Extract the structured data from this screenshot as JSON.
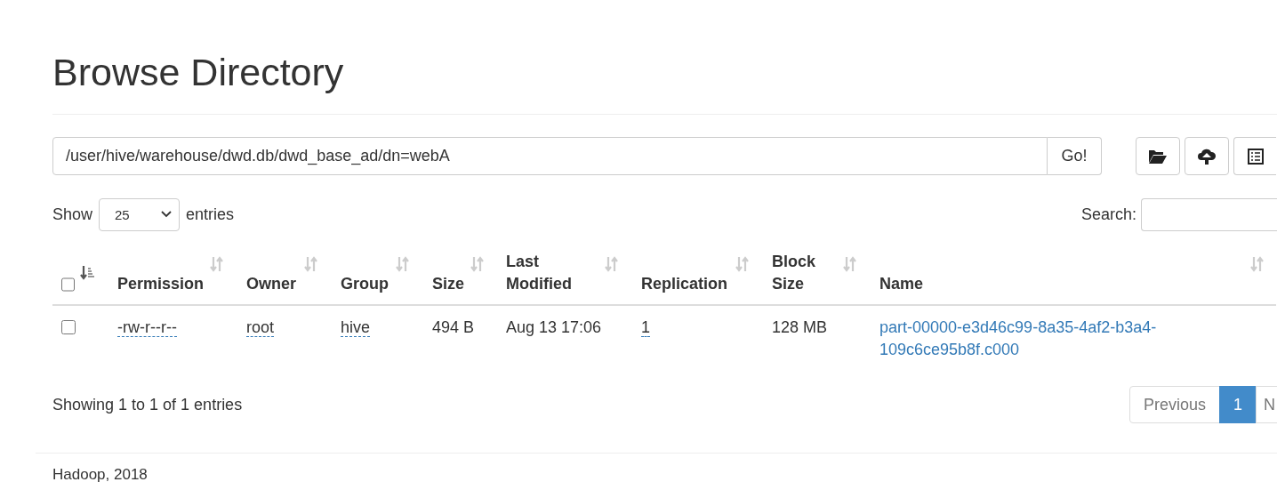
{
  "page": {
    "title": "Browse Directory"
  },
  "path_bar": {
    "value": "/user/hive/warehouse/dwd.db/dwd_base_ad/dn=webA",
    "go_label": "Go!"
  },
  "toolbar": [
    {
      "kind": "folder"
    },
    {
      "kind": "upload"
    },
    {
      "kind": "list"
    }
  ],
  "length_menu": {
    "before": "Show",
    "value": "25",
    "after": "entries"
  },
  "search": {
    "label": "Search:"
  },
  "table": {
    "select_all": {
      "checked": false
    },
    "columns": [
      {
        "kind": "checkbox",
        "sorted": true
      },
      {
        "label": "Permission",
        "sorted": false
      },
      {
        "label": "Owner",
        "sorted": false
      },
      {
        "label": "Group",
        "sorted": false
      },
      {
        "label": "Size",
        "sorted": false
      },
      {
        "label": "Last Modified",
        "sorted": false
      },
      {
        "label": "Replication",
        "sorted": false
      },
      {
        "label": "Block Size",
        "sorted": false
      },
      {
        "label": "Name",
        "sorted": false
      }
    ],
    "rows": [
      {
        "cells": [
          {
            "kind": "checkbox",
            "checked": false
          },
          {
            "text": "-rw-r--r--",
            "kind": "dotted"
          },
          {
            "text": "root",
            "kind": "dotted"
          },
          {
            "text": "hive",
            "kind": "dotted"
          },
          {
            "text": "494 B",
            "kind": "plain"
          },
          {
            "text": "Aug 13 17:06",
            "kind": "plain"
          },
          {
            "text": "1",
            "kind": "dotted"
          },
          {
            "text": "128 MB",
            "kind": "plain"
          },
          {
            "text": "part-00000-e3d46c99-8a35-4af2-b3a4-109c6ce95b8f.c000",
            "kind": "link"
          }
        ]
      }
    ]
  },
  "info": "Showing 1 to 1 of 1 entries",
  "pagination": [
    {
      "label": "Previous",
      "selected": false
    },
    {
      "label": "1",
      "selected": true
    },
    {
      "label": "N",
      "selected": false
    }
  ],
  "footer": "Hadoop, 2018"
}
